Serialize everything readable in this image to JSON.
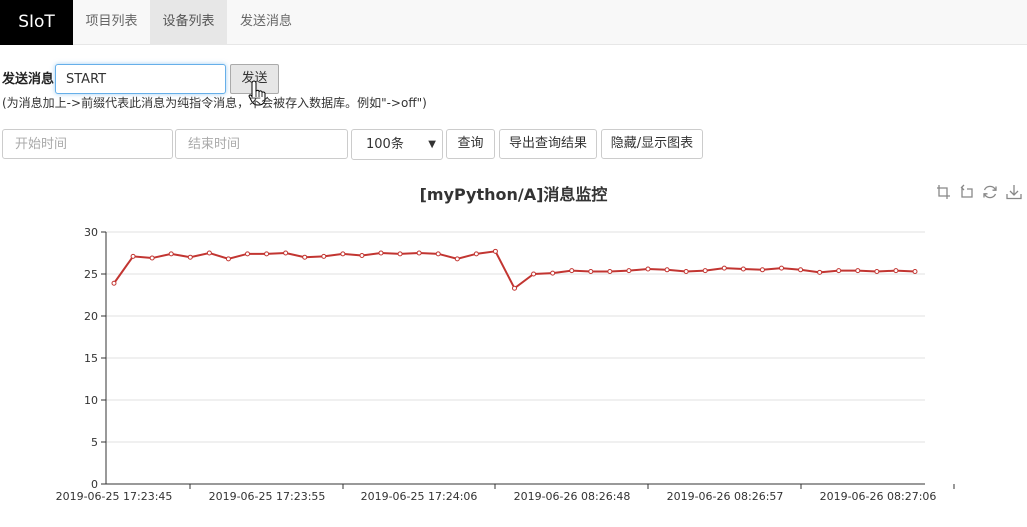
{
  "navbar": {
    "brand": "SIoT",
    "items": [
      {
        "label": "项目列表",
        "active": false
      },
      {
        "label": "设备列表",
        "active": true
      },
      {
        "label": "发送消息",
        "active": false
      }
    ]
  },
  "send_form": {
    "label": "发送消息",
    "input_value": "START",
    "button_label": "发送",
    "hint": "(为消息加上->前缀代表此消息为纯指令消息，不会被存入数据库。例如\"->off\")"
  },
  "query_bar": {
    "start_placeholder": "开始时间",
    "end_placeholder": "结束时间",
    "limit_selected": "100条",
    "query_button": "查询",
    "export_button": "导出查询结果",
    "toggle_chart_button": "隐藏/显示图表"
  },
  "chart_data": {
    "type": "line",
    "title": "[myPython/A]消息监控",
    "xlabel": "",
    "ylabel": "",
    "ylim": [
      0,
      30
    ],
    "y_ticks": [
      0,
      5,
      10,
      15,
      20,
      25,
      30
    ],
    "grid": true,
    "x_tick_labels": [
      "2019-06-25 17:23:45",
      "2019-06-25 17:23:55",
      "2019-06-25 17:24:06",
      "2019-06-26 08:26:48",
      "2019-06-26 08:26:57",
      "2019-06-26 08:27:06"
    ],
    "series": [
      {
        "color": "#c23531",
        "values": [
          23.9,
          27.1,
          26.9,
          27.4,
          27.0,
          27.5,
          26.8,
          27.4,
          27.4,
          27.5,
          27.0,
          27.1,
          27.4,
          27.2,
          27.5,
          27.4,
          27.5,
          27.4,
          26.8,
          27.4,
          27.7,
          23.3,
          25.0,
          25.1,
          25.4,
          25.3,
          25.3,
          25.4,
          25.6,
          25.5,
          25.3,
          25.4,
          25.7,
          25.6,
          25.5,
          25.7,
          25.5,
          25.2,
          25.4,
          25.4,
          25.3,
          25.4,
          25.3
        ]
      }
    ]
  },
  "chart_toolbox": [
    "crop-zoom-icon",
    "zoom-reset-icon",
    "restore-icon",
    "save-image-icon"
  ]
}
